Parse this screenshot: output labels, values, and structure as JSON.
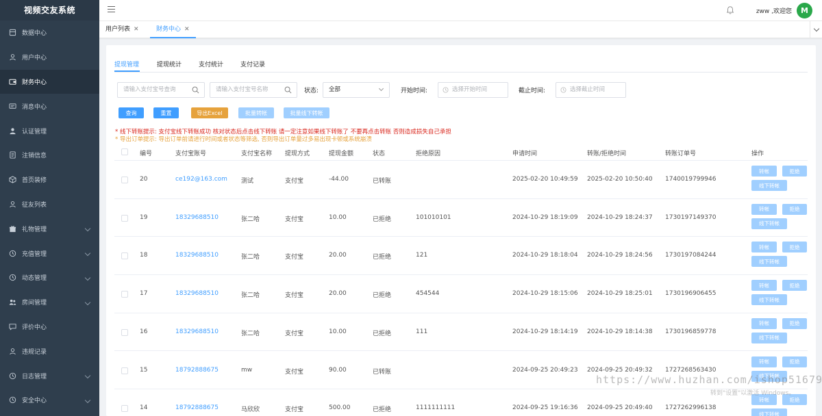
{
  "app": {
    "title": "视频交友系统"
  },
  "sidebar": {
    "items": [
      {
        "label": "数据中心",
        "icon": "dashboard-icon",
        "has_arrow": false
      },
      {
        "label": "用户中心",
        "icon": "user-icon",
        "has_arrow": false
      },
      {
        "label": "财务中心",
        "icon": "wallet-icon",
        "has_arrow": false,
        "active": true
      },
      {
        "label": "消息中心",
        "icon": "message-icon",
        "has_arrow": false
      },
      {
        "label": "认证管理",
        "icon": "person-icon",
        "has_arrow": false
      },
      {
        "label": "注销信息",
        "icon": "document-icon",
        "has_arrow": false
      },
      {
        "label": "首页装修",
        "icon": "box-icon",
        "has_arrow": false
      },
      {
        "label": "征友列表",
        "icon": "user-icon",
        "has_arrow": false
      },
      {
        "label": "礼物管理",
        "icon": "gift-icon",
        "has_arrow": true
      },
      {
        "label": "充值管理",
        "icon": "clock-icon",
        "has_arrow": true
      },
      {
        "label": "动态管理",
        "icon": "clock-icon",
        "has_arrow": true
      },
      {
        "label": "房间管理",
        "icon": "group-icon",
        "has_arrow": true
      },
      {
        "label": "评价中心",
        "icon": "chat-icon",
        "has_arrow": false
      },
      {
        "label": "违规记录",
        "icon": "user-icon",
        "has_arrow": false
      },
      {
        "label": "日志管理",
        "icon": "clock-icon",
        "has_arrow": true
      },
      {
        "label": "安全中心",
        "icon": "clock-icon",
        "has_arrow": true
      }
    ]
  },
  "header": {
    "welcome": "zww ,欢迎您",
    "avatar_text": "M"
  },
  "tabs": [
    {
      "label": "用户列表",
      "close": "✕",
      "active": false
    },
    {
      "label": "财务中心",
      "close": "✕",
      "active": true
    }
  ],
  "inner_tabs": [
    "提现管理",
    "提现统计",
    "支付统计",
    "支付记录"
  ],
  "filters": {
    "account_placeholder": "请输入支付宝号查询",
    "name_placeholder": "请输入支付宝号名称",
    "status_label": "状态:",
    "status_value": "全部",
    "start_label": "开始时间:",
    "start_placeholder": "选择开始时间",
    "end_label": "截止时间:",
    "end_placeholder": "选择截止时间"
  },
  "buttons": {
    "query": "查询",
    "reset": "重置",
    "export": "导出Excel",
    "batch_transfer": "批量转帐",
    "batch_offline": "批量线下转帐"
  },
  "tips": {
    "line1": "* 线下转账提示:  支付宝线下转账成功 核对状态后点击线下转账 请一定注意如果线下转账了 不要再点击转账 否则造成损失自己承担",
    "line2": "* 导出订单提示:  导出订单前请进行时间或者状态等筛选, 否则导出订单量过多易出现卡顿或系统崩溃"
  },
  "table": {
    "headers": [
      "编号",
      "支付宝账号",
      "支付宝名称",
      "提现方式",
      "提现金额",
      "状态",
      "拒绝原因",
      "申请时间",
      "转账/拒绝时间",
      "转账订单号",
      "操作"
    ],
    "rows": [
      {
        "id": "20",
        "account": "ce192@163.com",
        "name": "测试",
        "method": "支付宝",
        "amount": "-44.00",
        "status": "已转账",
        "reason": "",
        "apply_time": "2025-02-20 10:49:59",
        "done_time": "2025-02-20 10:50:40",
        "order": "1740019799946"
      },
      {
        "id": "19",
        "account": "18329688510",
        "name": "张二哈",
        "method": "支付宝",
        "amount": "10.00",
        "status": "已拒绝",
        "reason": "101010101",
        "apply_time": "2024-10-29 18:19:09",
        "done_time": "2024-10-29 18:24:37",
        "order": "1730197149370"
      },
      {
        "id": "18",
        "account": "18329688510",
        "name": "张二哈",
        "method": "支付宝",
        "amount": "20.00",
        "status": "已拒绝",
        "reason": "121",
        "apply_time": "2024-10-29 18:18:04",
        "done_time": "2024-10-29 18:24:56",
        "order": "1730197084244"
      },
      {
        "id": "17",
        "account": "18329688510",
        "name": "张二哈",
        "method": "支付宝",
        "amount": "20.00",
        "status": "已拒绝",
        "reason": "454544",
        "apply_time": "2024-10-29 18:15:06",
        "done_time": "2024-10-29 18:25:01",
        "order": "1730196906455"
      },
      {
        "id": "16",
        "account": "18329688510",
        "name": "张二哈",
        "method": "支付宝",
        "amount": "10.00",
        "status": "已拒绝",
        "reason": "111",
        "apply_time": "2024-10-29 18:14:19",
        "done_time": "2024-10-29 18:14:38",
        "order": "1730196859778"
      },
      {
        "id": "15",
        "account": "18792888675",
        "name": "mw",
        "method": "支付宝",
        "amount": "90.00",
        "status": "已转账",
        "reason": "",
        "apply_time": "2024-09-25 20:49:23",
        "done_time": "2024-09-25 20:49:32",
        "order": "1727268563430"
      },
      {
        "id": "14",
        "account": "18792888675",
        "name": "马欣欣",
        "method": "支付宝",
        "amount": "500.00",
        "status": "已拒绝",
        "reason": "1111111111",
        "apply_time": "2024-09-25 19:16:36",
        "done_time": "2024-09-25 20:49:40",
        "order": "1727262996138"
      }
    ],
    "actions": {
      "transfer": "转帐",
      "reject": "拒绝",
      "offline": "线下转帐"
    }
  },
  "overlay": {
    "watermark": "https://www.huzhan.com/ishop51679",
    "activate": "转到\"设置\"以激活 Windows。"
  },
  "colors": {
    "primary": "#409eff",
    "sidebar": "#2f3e4d",
    "warning": "#e6a23c",
    "danger": "#d9261c"
  }
}
